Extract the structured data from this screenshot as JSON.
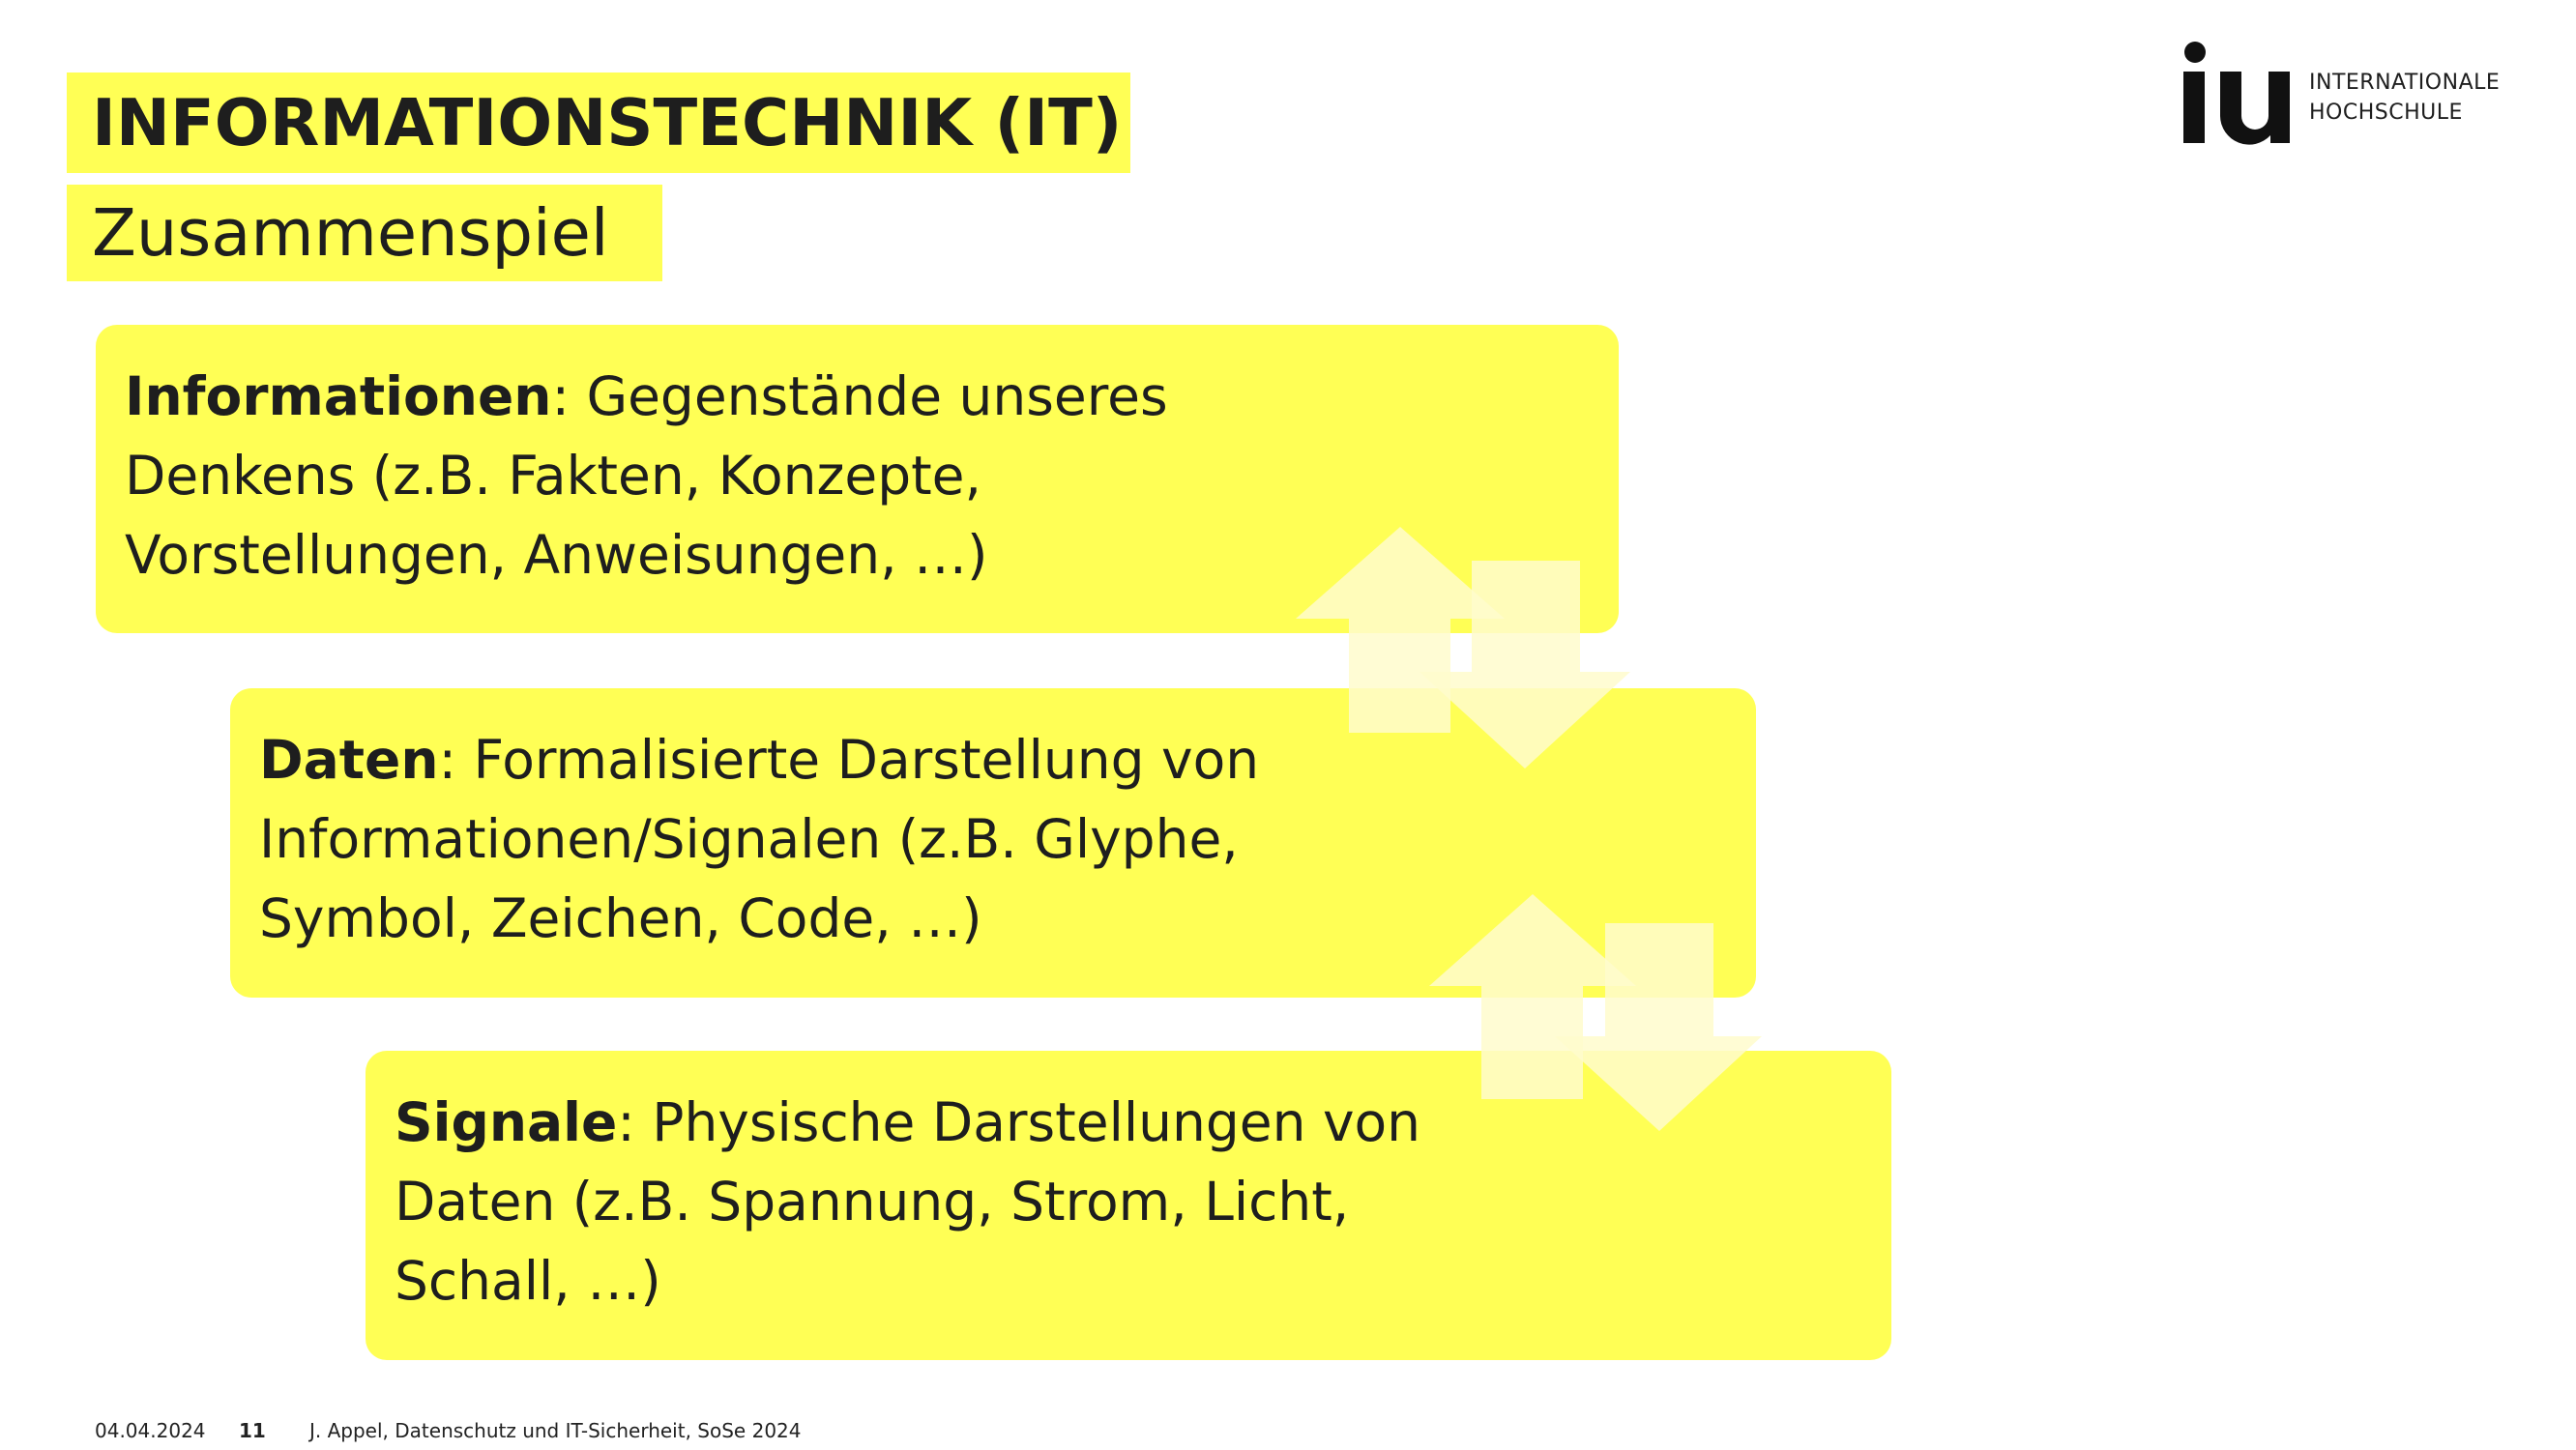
{
  "header": {
    "title": "INFORMATIONSTECHNIK (IT)",
    "subtitle": "Zusammenspiel"
  },
  "logo": {
    "mark": "iu",
    "line1": "INTERNATIONALE",
    "line2": "HOCHSCHULE"
  },
  "boxes": [
    {
      "term": "Informationen",
      "text": ": Gegenstände unseres Denkens (z.B. Fakten, Konzepte, Vorstellungen, Anweisungen, …)",
      "lines": [
        "Denkens (z.B. Fakten, Konzepte,",
        "Vorstellungen, Anweisungen, …)"
      ],
      "first": ": Gegenstände unseres"
    },
    {
      "term": "Daten",
      "first": ": Formalisierte Darstellung von",
      "lines": [
        "Informationen/Signalen (z.B. Glyphe,",
        "Symbol, Zeichen, Code, …)"
      ]
    },
    {
      "term": "Signale",
      "first": ": Physische Darstellungen von",
      "lines": [
        "Daten (z.B. Spannung, Strom, Licht,",
        "Schall, …)"
      ]
    }
  ],
  "icons": {
    "up_arrow": "arrow-up-icon",
    "down_arrow": "arrow-down-icon"
  },
  "colors": {
    "box_yellow": "#ffff55",
    "arrow_light": "#fffccc"
  },
  "footer": {
    "date": "04.04.2024",
    "page": "11",
    "author": "J. Appel, Datenschutz und IT-Sicherheit, SoSe 2024"
  }
}
